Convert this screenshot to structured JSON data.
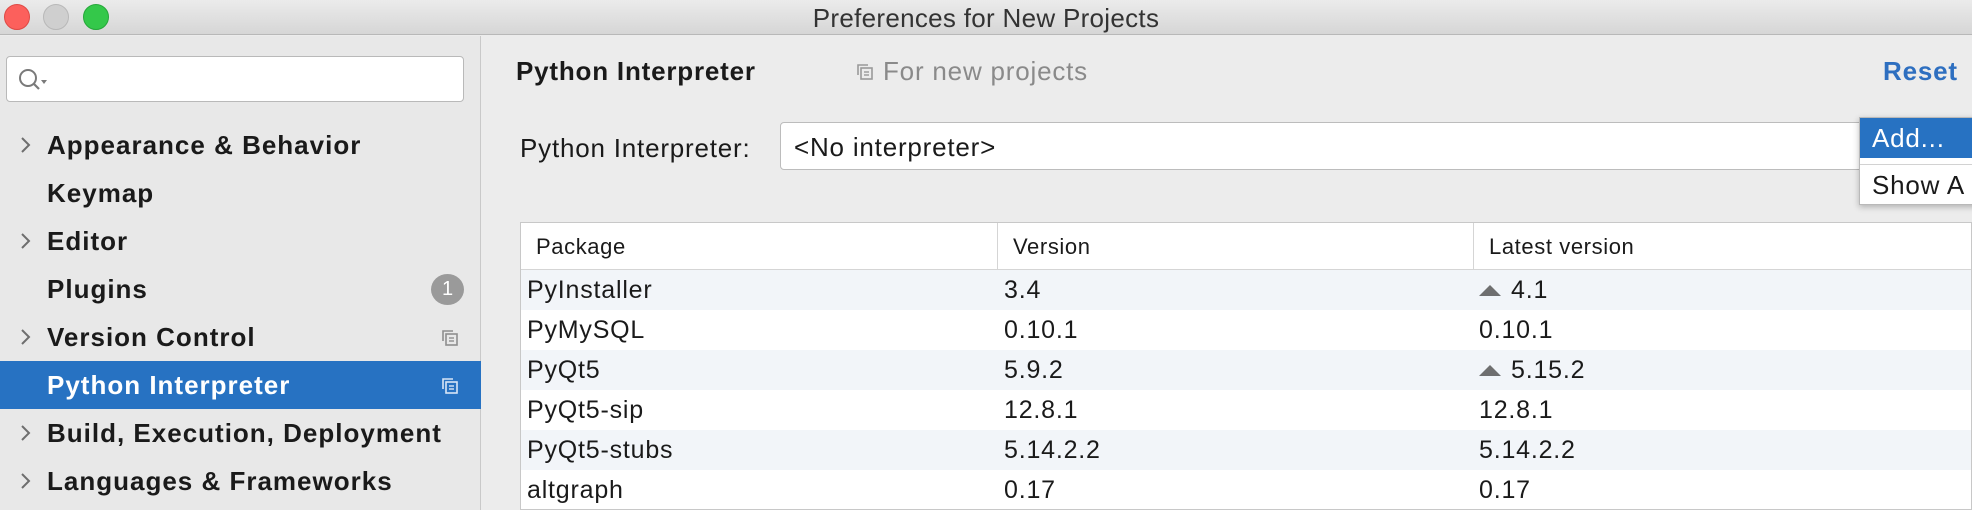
{
  "window": {
    "title": "Preferences for New Projects"
  },
  "search": {
    "placeholder": "",
    "value": ""
  },
  "sidebar": {
    "items": [
      {
        "label": "Appearance & Behavior",
        "expandable": true
      },
      {
        "label": "Keymap",
        "expandable": false
      },
      {
        "label": "Editor",
        "expandable": true
      },
      {
        "label": "Plugins",
        "expandable": false,
        "badge": "1"
      },
      {
        "label": "Version Control",
        "expandable": true,
        "icon": "copy-icon"
      },
      {
        "label": "Python Interpreter",
        "expandable": false,
        "icon": "copy-icon",
        "selected": true
      },
      {
        "label": "Build, Execution, Deployment",
        "expandable": true
      },
      {
        "label": "Languages & Frameworks",
        "expandable": true
      }
    ]
  },
  "main": {
    "title": "Python Interpreter",
    "scope": "For new projects",
    "reset_label": "Reset",
    "interpreter_label": "Python Interpreter:",
    "interpreter_value": "<No interpreter>",
    "popup": {
      "items": [
        "Add...",
        "Show A"
      ]
    },
    "table": {
      "columns": [
        "Package",
        "Version",
        "Latest version"
      ],
      "rows": [
        {
          "package": "PyInstaller",
          "version": "3.4",
          "latest": "4.1",
          "upgrade": true
        },
        {
          "package": "PyMySQL",
          "version": "0.10.1",
          "latest": "0.10.1",
          "upgrade": false
        },
        {
          "package": "PyQt5",
          "version": "5.9.2",
          "latest": "5.15.2",
          "upgrade": true
        },
        {
          "package": "PyQt5-sip",
          "version": "12.8.1",
          "latest": "12.8.1",
          "upgrade": false
        },
        {
          "package": "PyQt5-stubs",
          "version": "5.14.2.2",
          "latest": "5.14.2.2",
          "upgrade": false
        },
        {
          "package": "altgraph",
          "version": "0.17",
          "latest": "0.17",
          "upgrade": false
        }
      ]
    }
  },
  "colors": {
    "selection": "#2772c2",
    "link": "#2e6fc0",
    "badge": "#9a9a9a"
  }
}
